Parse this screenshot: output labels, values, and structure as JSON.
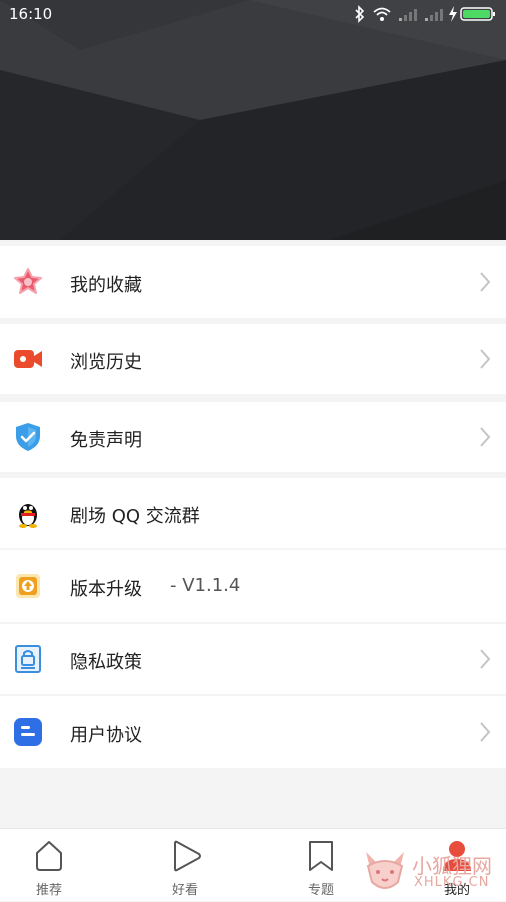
{
  "status_bar": {
    "time": "16:10",
    "icons": [
      "bluetooth-icon",
      "wifi-icon",
      "signal-icon",
      "signal-icon",
      "charging-icon",
      "battery-icon"
    ],
    "battery_color": "#4cd964"
  },
  "menu": {
    "items": [
      {
        "label": "我的收藏",
        "icon": "star-icon",
        "icon_color": "#e95a6c",
        "chevron": true
      },
      {
        "label": "浏览历史",
        "icon": "video-camera-icon",
        "icon_color": "#ec4a2c",
        "chevron": true
      },
      {
        "label": "免责声明",
        "icon": "shield-check-icon",
        "icon_color": "#3a9ee8",
        "chevron": true
      },
      {
        "label": "剧场 QQ 交流群",
        "icon": "qq-penguin-icon",
        "chevron": false
      },
      {
        "label": "版本升级",
        "version": "- V1.1.4",
        "icon": "upgrade-icon",
        "icon_color": "#f0a020",
        "chevron": false
      },
      {
        "label": "隐私政策",
        "icon": "lock-document-icon",
        "icon_color": "#3a8ee0",
        "chevron": true
      },
      {
        "label": "用户协议",
        "icon": "agreement-icon",
        "icon_color": "#2f6fe6",
        "chevron": true
      }
    ]
  },
  "bottom_nav": {
    "items": [
      {
        "label": "推荐",
        "icon": "home-icon"
      },
      {
        "label": "好看",
        "icon": "play-icon"
      },
      {
        "label": "专题",
        "icon": "bookmark-icon"
      },
      {
        "label": "我的",
        "icon": "user-icon",
        "active": true
      }
    ],
    "active_color": "#e84c3d"
  },
  "watermark": {
    "line1": "小狐狸网",
    "line2": "XHLKG.CN"
  }
}
